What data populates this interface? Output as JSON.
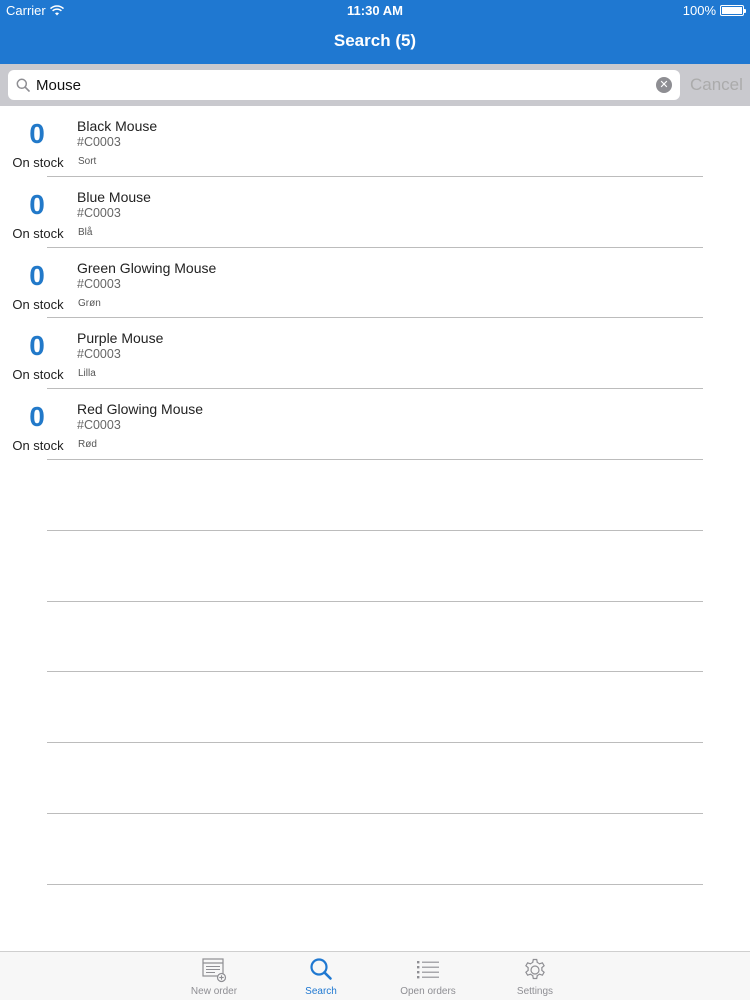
{
  "status_bar": {
    "carrier": "Carrier",
    "time": "11:30 AM",
    "battery": "100%"
  },
  "nav": {
    "title": "Search (5)"
  },
  "search": {
    "value": "Mouse",
    "cancel_label": "Cancel"
  },
  "results": [
    {
      "count": "0",
      "stock_label": "On stock",
      "name": "Black Mouse",
      "code": "#C0003",
      "variant": "Sort"
    },
    {
      "count": "0",
      "stock_label": "On stock",
      "name": "Blue Mouse",
      "code": "#C0003",
      "variant": "Blå"
    },
    {
      "count": "0",
      "stock_label": "On stock",
      "name": "Green Glowing Mouse",
      "code": "#C0003",
      "variant": "Grøn"
    },
    {
      "count": "0",
      "stock_label": "On stock",
      "name": "Purple Mouse",
      "code": "#C0003",
      "variant": "Lilla"
    },
    {
      "count": "0",
      "stock_label": "On stock",
      "name": "Red Glowing Mouse",
      "code": "#C0003",
      "variant": "Rød"
    }
  ],
  "tabs": [
    {
      "label": "New order",
      "icon": "new-order-icon",
      "active": false
    },
    {
      "label": "Search",
      "icon": "search-icon",
      "active": true
    },
    {
      "label": "Open orders",
      "icon": "list-icon",
      "active": false
    },
    {
      "label": "Settings",
      "icon": "gear-icon",
      "active": false
    }
  ],
  "colors": {
    "accent": "#1f78d1",
    "stock_count": "#2279c9",
    "searchbar_bg": "#c9c9ce",
    "inactive_tab": "#8e8e93"
  }
}
